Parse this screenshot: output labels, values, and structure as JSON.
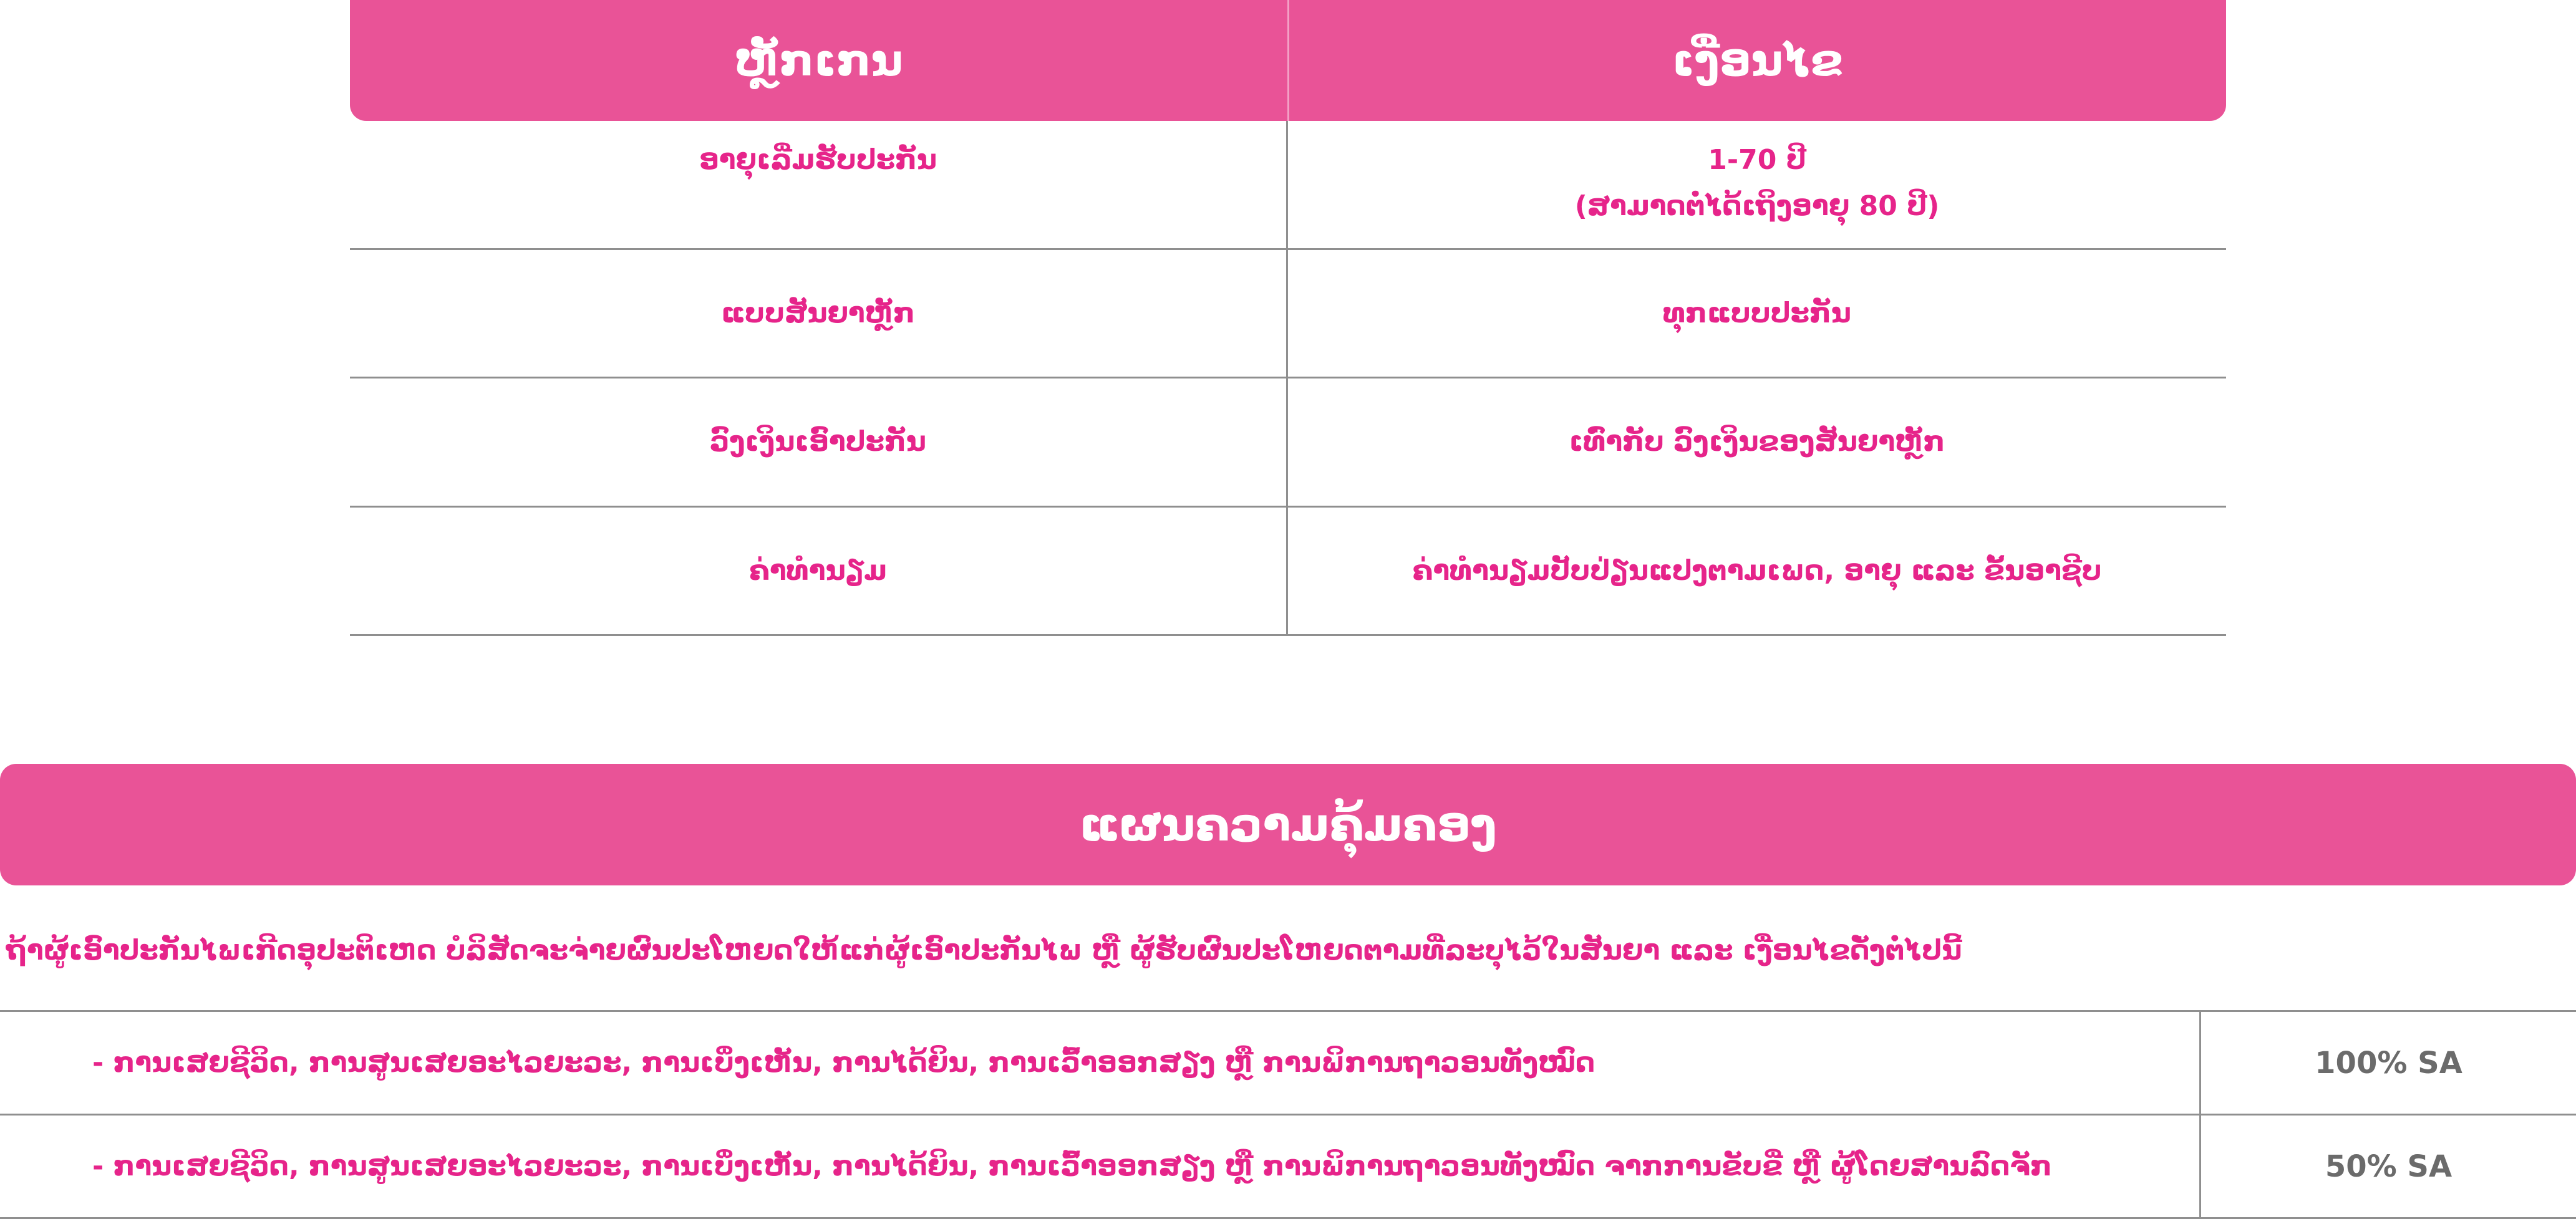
{
  "criteria_table": {
    "headers": [
      "ຫຼັກເກນ",
      "ເງື່ອນໄຂ"
    ],
    "rows": [
      {
        "label": "ອາຍຸເລີ່ມຮັບປະກັນ",
        "value_lines": [
          "1-70 ປີ",
          "(ສາມາດຕໍ່ໄດ້ເຖິງອາຍຸ 80 ປີ)"
        ]
      },
      {
        "label": "ແບບສັນຍາຫຼັກ",
        "value_lines": [
          "ທຸກແບບປະກັນ"
        ]
      },
      {
        "label": "ວົງເງິນເອົາປະກັນ",
        "value_lines": [
          "ເທົ່າກັບ ວົງເງິນຂອງສັນຍາຫຼັກ"
        ]
      },
      {
        "label": "ຄ່າທຳນຽມ",
        "value_lines": [
          "ຄ່າທຳນຽມປັບປ່ຽນແປງຕາມເພດ, ອາຍຸ ແລະ ຂັ້ນອາຊີບ"
        ]
      }
    ]
  },
  "coverage": {
    "title": "ແຜນຄວາມຄຸ້ມຄອງ",
    "intro": "ຖ້າຜູ້ເອົາປະກັນໄພເກີດອຸປະຕິເຫດ ບໍລິສັດຈະຈ່າຍຜົນປະໂຫຍດໃຫ້ແກ່ຜູ້ເອົາປະກັນໄພ ຫຼື ຜູ້ຮັບຜົນປະໂຫຍດຕາມທີ່ລະບຸໄວ້ໃນສັນຍາ ແລະ ເງື່ອນໄຂດັ່ງຕໍ່ໄປນີ້",
    "rows": [
      {
        "description": "- ການເສຍຊີວິດ, ການສູນເສຍອະໄວຍະວະ, ການເບິ່ງເຫັນ, ການໄດ້ຍິນ, ການເວົ້າອອກສຽງ ຫຼື ການພິການຖາວອນທັງໝົດ",
        "benefit": "100% SA"
      },
      {
        "description": "- ການເສຍຊີວິດ, ການສູນເສຍອະໄວຍະວະ, ການເບິ່ງເຫັນ, ການໄດ້ຍິນ, ການເວົ້າອອກສຽງ ຫຼື ການພິການຖາວອນທັງໝົດ ຈາກການຂັບຂີ່ ຫຼື ຜູ້ໂດຍສານລົດຈັກ",
        "benefit": "50% SA"
      }
    ]
  },
  "colors": {
    "accent_pink": "#e95397",
    "text_pink": "#e6248a",
    "value_gray": "#6b6b6b",
    "rule_gray": "#8f8f8f"
  }
}
